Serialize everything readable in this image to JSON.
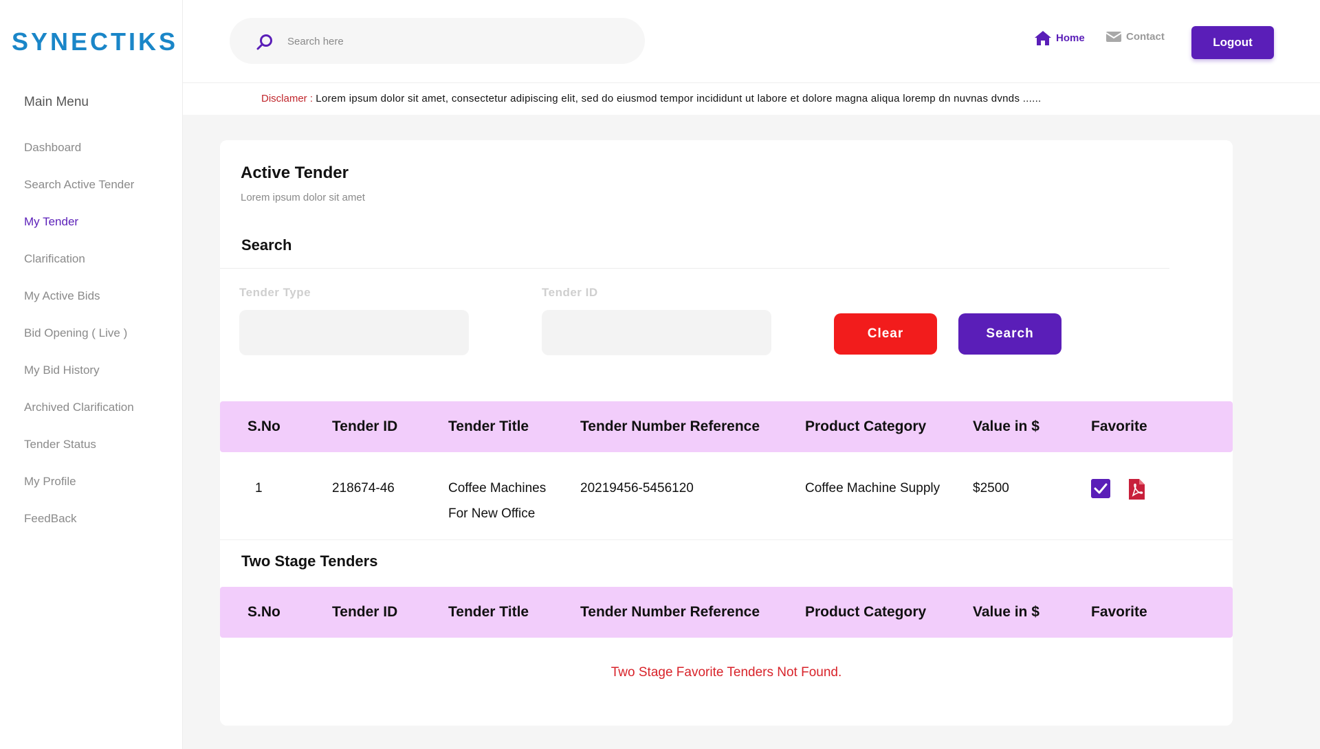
{
  "sidebar": {
    "logo": "SYNECTIKS",
    "menu_title": "Main Menu",
    "items": [
      {
        "label": "Dashboard"
      },
      {
        "label": "Search Active Tender"
      },
      {
        "label": "My Tender"
      },
      {
        "label": "Clarification"
      },
      {
        "label": "My Active Bids"
      },
      {
        "label": "Bid Opening ( Live )"
      },
      {
        "label": "My Bid History"
      },
      {
        "label": "Archived Clarification"
      },
      {
        "label": "Tender Status"
      },
      {
        "label": "My Profile"
      },
      {
        "label": "FeedBack"
      }
    ],
    "active_item": "My Tender"
  },
  "header": {
    "search_placeholder": "Search here",
    "home_label": "Home",
    "contact_label": "Contact",
    "logout_label": "Logout"
  },
  "disclaimer": {
    "label": "Disclamer",
    "separator": ":",
    "text": "Lorem ipsum dolor sit amet, consectetur adipiscing elit, sed do eiusmod tempor incididunt ut labore et dolore magna aliqua loremp dn  nuvnas dvnds ......"
  },
  "card": {
    "title": "Active Tender",
    "subtitle": "Lorem ipsum dolor sit amet",
    "search_section": {
      "title": "Search",
      "tender_type_label": "Tender Type",
      "tender_type_value": "",
      "tender_id_label": "Tender ID",
      "tender_id_value": "",
      "clear_label": "Clear",
      "search_label": "Search"
    },
    "columns": [
      "S.No",
      "Tender ID",
      "Tender Title",
      "Tender Number Reference",
      "Product Category",
      "Value in $",
      "Favorite"
    ],
    "rows": [
      {
        "sno": "1",
        "tender_id": "218674-46",
        "title": "Coffee Machines For New Office",
        "reference": "20219456-5456120",
        "category": "Coffee Machine Supply",
        "value": "$2500",
        "favorite": true
      }
    ],
    "two_stage": {
      "title": "Two Stage Tenders",
      "empty_message": "Two Stage Favorite Tenders Not Found."
    }
  },
  "colors": {
    "brand_primary": "#5a1eb8",
    "logo_blue": "#1a86c8",
    "logo_accent": "#e8334a",
    "clear_red": "#f21c1c",
    "table_header": "#f2cdfb",
    "error_text": "#d8232a"
  },
  "icons": {
    "search": "search-icon",
    "home": "home-icon",
    "contact": "mail-icon",
    "favorite": "checkbox-checked-icon",
    "pdf": "pdf-icon"
  }
}
